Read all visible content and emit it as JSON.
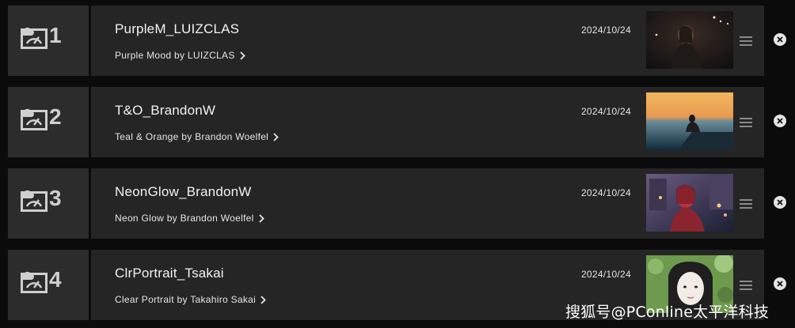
{
  "presets": [
    {
      "slot": "1",
      "name": "PurpleM_LUIZCLAS",
      "description": "Purple Mood by LUIZCLAS",
      "date": "2024/10/24",
      "thumbnail": "woman at night on dim street",
      "colors": [
        "#1a1515",
        "#3a2b24",
        "#0d0d10"
      ]
    },
    {
      "slot": "2",
      "name": "T&O_BrandonW",
      "description": "Teal & Orange by Brandon Woelfel",
      "date": "2024/10/24",
      "thumbnail": "person sitting on pier at sunset",
      "colors": [
        "#f0a050",
        "#2a5a70",
        "#0f2a3a"
      ]
    },
    {
      "slot": "3",
      "name": "NeonGlow_BrandonW",
      "description": "Neon Glow by Brandon Woelfel",
      "date": "2024/10/24",
      "thumbnail": "woman with red neon light on city street",
      "colors": [
        "#c0303a",
        "#6a5a80",
        "#1a2035"
      ]
    },
    {
      "slot": "4",
      "name": "ClrPortrait_Tsakai",
      "description": "Clear Portrait by Takahiro Sakai",
      "date": "2024/10/24",
      "thumbnail": "girl portrait in green foliage",
      "colors": [
        "#6e9a4e",
        "#f1ece6",
        "#1f1f1f"
      ]
    }
  ],
  "icons": {
    "preset_slot": "image-gauge-icon",
    "cloud": "cloud-icon",
    "chevron": "chevron-right-icon",
    "handle": "drag-handle-icon",
    "remove": "close-circle-icon"
  },
  "watermark": "搜狐号@PConline太平洋科技"
}
